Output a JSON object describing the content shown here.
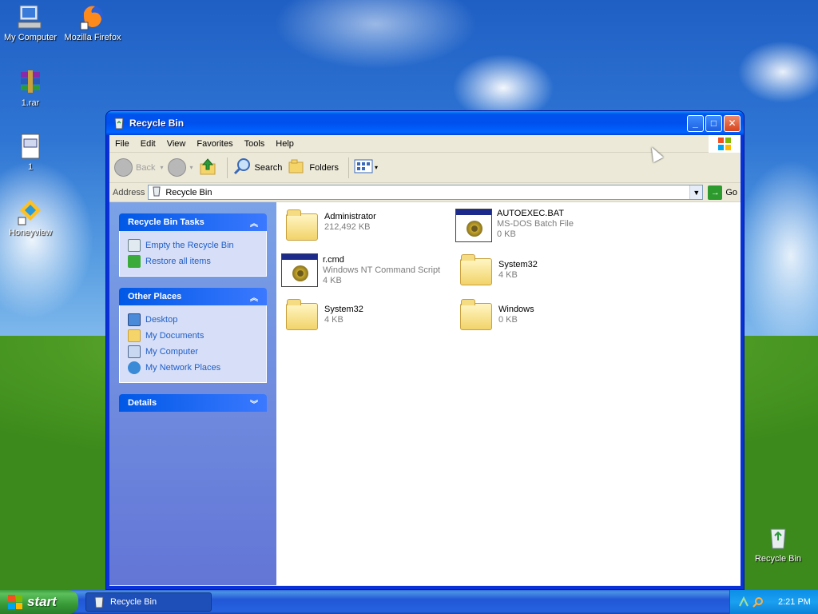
{
  "desktop": {
    "icons": [
      {
        "label": "My Computer",
        "icon": "computer-icon"
      },
      {
        "label": "Mozilla Firefox",
        "icon": "firefox-icon"
      },
      {
        "label": "1.rar",
        "icon": "winrar-archive-icon"
      },
      {
        "label": "1",
        "icon": "document-icon"
      },
      {
        "label": "Honeyview",
        "icon": "honeyview-icon"
      },
      {
        "label": "Recycle Bin",
        "icon": "recycle-bin-icon"
      }
    ]
  },
  "window": {
    "title": "Recycle Bin",
    "menu": [
      "File",
      "Edit",
      "View",
      "Favorites",
      "Tools",
      "Help"
    ],
    "toolbar": {
      "back_label": "Back",
      "search_label": "Search",
      "folders_label": "Folders"
    },
    "address": {
      "label": "Address",
      "value": "Recycle Bin",
      "go_label": "Go"
    },
    "taskpane": {
      "tasks_title": "Recycle Bin Tasks",
      "tasks": [
        "Empty the Recycle Bin",
        "Restore all items"
      ],
      "places_title": "Other Places",
      "places": [
        "Desktop",
        "My Documents",
        "My Computer",
        "My Network Places"
      ],
      "details_title": "Details"
    },
    "files": [
      {
        "name": "Administrator",
        "sub": "212,492 KB",
        "icon": "folder-icon"
      },
      {
        "name": "AUTOEXEC.BAT",
        "sub1": "MS-DOS Batch File",
        "sub": "0 KB",
        "icon": "batch-file-icon"
      },
      {
        "name": "r.cmd",
        "sub1": "Windows NT Command Script",
        "sub": "4 KB",
        "icon": "command-script-icon"
      },
      {
        "name": "System32",
        "sub": "4 KB",
        "icon": "folder-icon"
      },
      {
        "name": "System32",
        "sub": "4 KB",
        "icon": "folder-icon"
      },
      {
        "name": "Windows",
        "sub": "0 KB",
        "icon": "folder-icon"
      }
    ]
  },
  "taskbar": {
    "start_label": "start",
    "task_label": "Recycle Bin",
    "clock": "2:21 PM"
  },
  "colors": {
    "title_blue": "#0053ee",
    "taskpane_blue": "#6375d6",
    "link_blue": "#215dc6",
    "start_green": "#379a37"
  }
}
